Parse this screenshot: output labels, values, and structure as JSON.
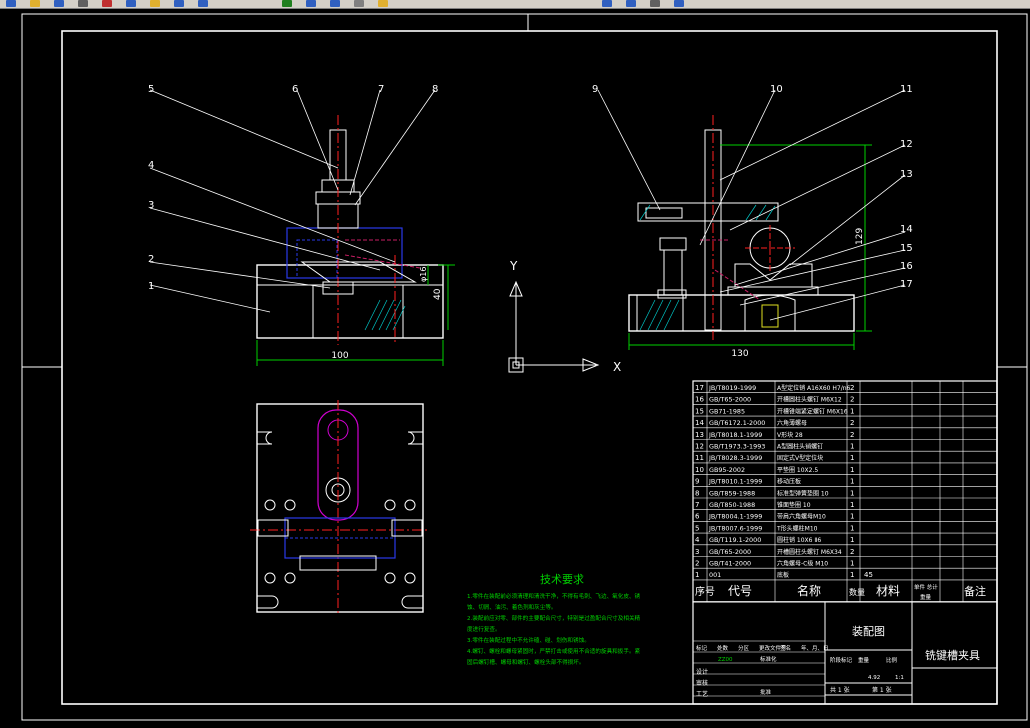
{
  "colors": {
    "background": "#000000",
    "line": "#ffffff",
    "hidden": "#c81e64",
    "blue": "#2a3ae8",
    "magenta": "#d000d0",
    "green": "#00d000",
    "center": "#ff2020",
    "cyan": "#00c8c8",
    "yellow": "#e0e020"
  },
  "toolbar": {
    "icons": [
      "new-icon",
      "open-icon",
      "save-icon",
      "print-icon",
      "cut-icon",
      "copy-icon",
      "paste-icon",
      "undo-icon",
      "redo-icon",
      "pan-icon",
      "zoom-icon",
      "zoom-window-icon",
      "properties-icon",
      "layer-icon",
      "match-icon",
      "help-icon",
      "dimension-icon",
      "object-icon"
    ]
  },
  "callouts": [
    "1",
    "2",
    "3",
    "4",
    "5",
    "6",
    "7",
    "8",
    "9",
    "10",
    "11",
    "12",
    "13",
    "14",
    "15",
    "16",
    "17"
  ],
  "dimensions": {
    "front_width": "100",
    "front_height": "40",
    "front_small": "φ16",
    "side_width": "130",
    "side_height": "129"
  },
  "ucs": {
    "y": "Y",
    "x": "X"
  },
  "tech_req": {
    "title": "技术要求",
    "lines": [
      "1.零件在装配前必须清理和清洗干净，不得有毛刺、飞边、氧化皮、锈",
      "蚀、切屑、油污、着色剂和灰尘等。",
      "2.装配前应对零、部件的主要配合尺寸，特别是过盈配合尺寸及相关精",
      "度进行复查。",
      "3.零件在装配过程中不允许磕、碰、划伤和锈蚀。",
      "4.螺钉、螺栓和螺母紧固时，严禁打击或使用不合适的旋具和扳手。紧",
      "固后螺钉槽、螺母和螺钉、螺栓头部不得损坏。"
    ]
  },
  "bom": {
    "rows": [
      {
        "no": "17",
        "code": "JB/T8019-1999",
        "name": "A型定位销 A16X60 H7/n6",
        "qty": "2"
      },
      {
        "no": "16",
        "code": "GB/T65-2000",
        "name": "开槽圆柱头螺钉 M6X12",
        "qty": "2"
      },
      {
        "no": "15",
        "code": "GB71-1985",
        "name": "开槽锥端紧定螺钉 M6X16",
        "qty": "1"
      },
      {
        "no": "14",
        "code": "GB/T6172.1-2000",
        "name": "六角薄螺母",
        "qty": "2"
      },
      {
        "no": "13",
        "code": "JB/T8018.1-1999",
        "name": "V形块 28",
        "qty": "2"
      },
      {
        "no": "12",
        "code": "GB/T1973.3-1993",
        "name": "A型圆柱头销螺钉",
        "qty": "1"
      },
      {
        "no": "11",
        "code": "JB/T8028.3-1999",
        "name": "固定式V型定位块",
        "qty": "1"
      },
      {
        "no": "10",
        "code": "GB95-2002",
        "name": "平垫圈 10X2.5",
        "qty": "1"
      },
      {
        "no": "9",
        "code": "JB/T8010.1-1999",
        "name": "移动压板",
        "qty": "1"
      },
      {
        "no": "8",
        "code": "GB/T859-1988",
        "name": "标准型弹簧垫圈 10",
        "qty": "1"
      },
      {
        "no": "7",
        "code": "GB/T850-1988",
        "name": "锥面垫圈 10",
        "qty": "1"
      },
      {
        "no": "6",
        "code": "JB/T8004.1-1999",
        "name": "带肩六角螺母M10",
        "qty": "1"
      },
      {
        "no": "5",
        "code": "JB/T8007.6-1999",
        "name": "T形头螺柱M10",
        "qty": "1"
      },
      {
        "no": "4",
        "code": "GB/T119.1-2000",
        "name": "圆柱销 10X6 Ⅱ6",
        "qty": "1"
      },
      {
        "no": "3",
        "code": "GB/T65-2000",
        "name": "开槽圆柱头螺钉 M6X34",
        "qty": "2"
      },
      {
        "no": "2",
        "code": "GB/T41-2000",
        "name": "六角螺母-C级 M10",
        "qty": "1"
      },
      {
        "no": "1",
        "code": "001",
        "name": "底板",
        "qty": "1",
        "material": "45"
      }
    ],
    "header": {
      "seq": "序号",
      "code": "代号",
      "name": "名称",
      "qty": "数量",
      "material": "材料",
      "mass": "单件 总计",
      "mass_sub": "重量",
      "remark": "备注"
    }
  },
  "title_block": {
    "drawing_title": "装配图",
    "part_name": "铣键槽夹具",
    "scale": "1:1",
    "weight": "4.92",
    "sheets": "共 1 张",
    "sheet": "第 1 张",
    "stage_labels": [
      "阶段标记",
      "重量",
      "比例"
    ],
    "rev_headers": [
      "标记",
      "处数",
      "分区",
      "更改文件号",
      "签名",
      "年、月、日"
    ],
    "rows": [
      "设计",
      "审核",
      "工艺"
    ],
    "designer": "ZZ00",
    "std_label": "标准化",
    "approve_label": "批准"
  }
}
